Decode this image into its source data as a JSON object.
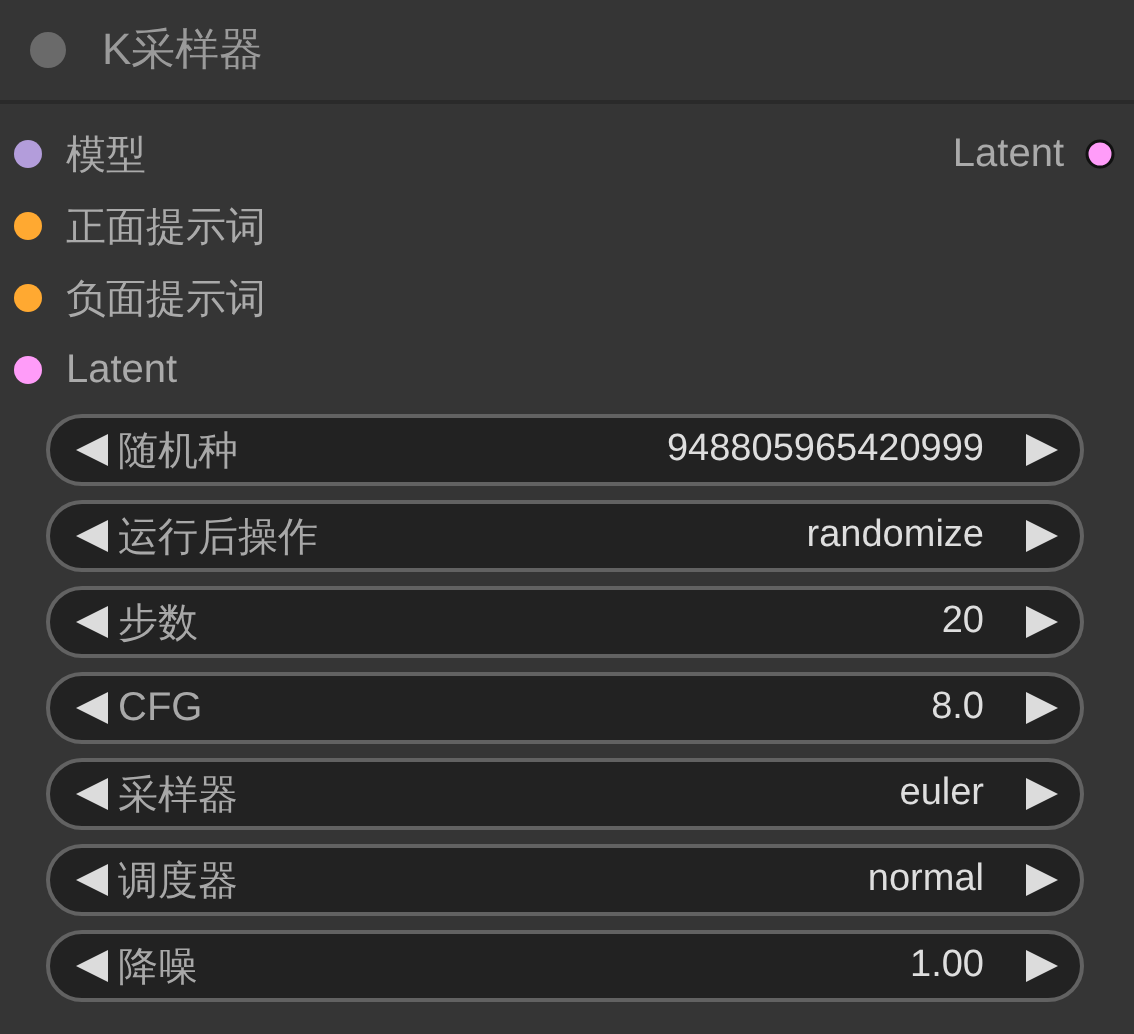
{
  "node": {
    "title": "K采样器"
  },
  "inputs": [
    {
      "label": "模型",
      "color": "#b39ddb"
    },
    {
      "label": "正面提示词",
      "color": "#ffa931"
    },
    {
      "label": "负面提示词",
      "color": "#ffa931"
    },
    {
      "label": "Latent",
      "color": "#ff9cf9"
    }
  ],
  "outputs": [
    {
      "label": "Latent",
      "color": "#ff9cf9"
    }
  ],
  "widgets": [
    {
      "label": "随机种",
      "value": "948805965420999"
    },
    {
      "label": "运行后操作",
      "value": "randomize"
    },
    {
      "label": "步数",
      "value": "20"
    },
    {
      "label": "CFG",
      "value": "8.0"
    },
    {
      "label": "采样器",
      "value": "euler"
    },
    {
      "label": "调度器",
      "value": "normal"
    },
    {
      "label": "降噪",
      "value": "1.00"
    }
  ]
}
